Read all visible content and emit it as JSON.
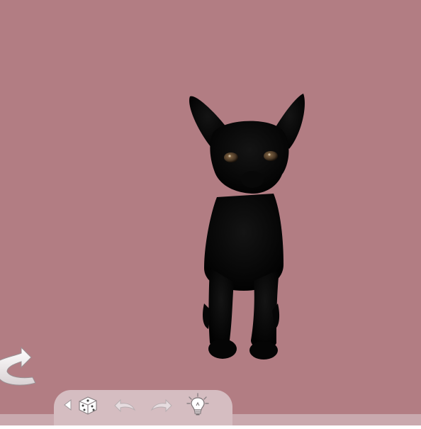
{
  "colors": {
    "background": "#b27d83",
    "toolbar": "#d5bdc1",
    "bottom_strip": "#c9a9ae",
    "icon_light": "#ffffff",
    "icon_shade": "#b8b0b2",
    "dog": "#050505",
    "eyes": "#6b5237"
  },
  "scene": {
    "subject": "black-puppy"
  },
  "toolbar": {
    "buttons": [
      {
        "name": "collapse-toolbar-button",
        "icon": "triangle-left-icon"
      },
      {
        "name": "random-dice-button",
        "icon": "dice-icon"
      },
      {
        "name": "undo-button",
        "icon": "undo-arrow-icon"
      },
      {
        "name": "redo-button",
        "icon": "redo-arrow-icon"
      },
      {
        "name": "hint-button",
        "icon": "lightbulb-icon"
      }
    ]
  },
  "navigation": {
    "back_icon": "curved-back-arrow-icon"
  }
}
